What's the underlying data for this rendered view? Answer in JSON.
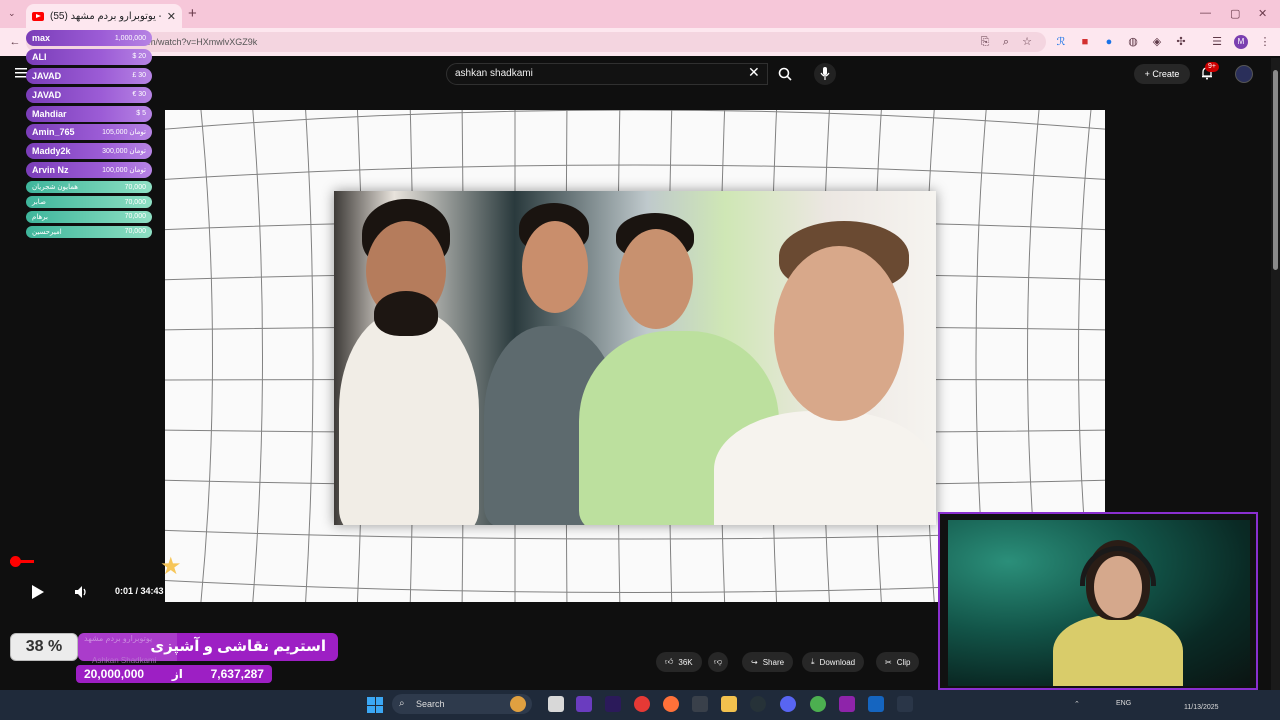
{
  "browser": {
    "tab_title": "یوتوبرارو بردم مشهد (55) - ...",
    "url": "m/watch?v=HXmwlvXGZ9k",
    "new_tab": "+"
  },
  "youtube": {
    "search_value": "ashkan shadkami",
    "create_label": "Create",
    "notif_count": "9+"
  },
  "donations": [
    {
      "name": "max",
      "amount": "1,000,000"
    },
    {
      "name": "ALI",
      "amount": "$ 20"
    },
    {
      "name": "JAVAD",
      "amount": "£ 30"
    },
    {
      "name": "JAVAD",
      "amount": "€ 30"
    },
    {
      "name": "Mahdiar",
      "amount": "$ 5"
    },
    {
      "name": "Amin_765",
      "amount": "105,000 تومان"
    },
    {
      "name": "Maddy2k",
      "amount": "300,000 تومان"
    },
    {
      "name": "Arvin Nz",
      "amount": "100,000 تومان"
    },
    {
      "name": "همایون شجریان",
      "amount": "70,000"
    },
    {
      "name": "صابر",
      "amount": "70,000"
    },
    {
      "name": "برهام",
      "amount": "70,000"
    },
    {
      "name": "امیرحسین",
      "amount": "70,000"
    }
  ],
  "player": {
    "time": "0:01 / 34:43",
    "progress_fraction": 0.0005
  },
  "overlay": {
    "percent": "38 %",
    "goal_fraction": 0.38,
    "goal_title": "استریم نقاشی و آشپزی",
    "faint_title": "یوتوبرارو بردم مشهد",
    "faint_channel": "Ashkan Shadkami",
    "goal_target": "20,000,000",
    "goal_from": "از",
    "goal_current": "7,637,287"
  },
  "actions": {
    "likes": "36K",
    "share": "Share",
    "download": "Download",
    "clip": "Clip"
  },
  "taskbar": {
    "search_placeholder": "Search",
    "lang": "ENG",
    "date": "11/13/2025"
  },
  "colors": {
    "accent": "#ff0000",
    "overlay_purple": "#9d1fc4",
    "tab_pink": "#f6c7d9"
  }
}
